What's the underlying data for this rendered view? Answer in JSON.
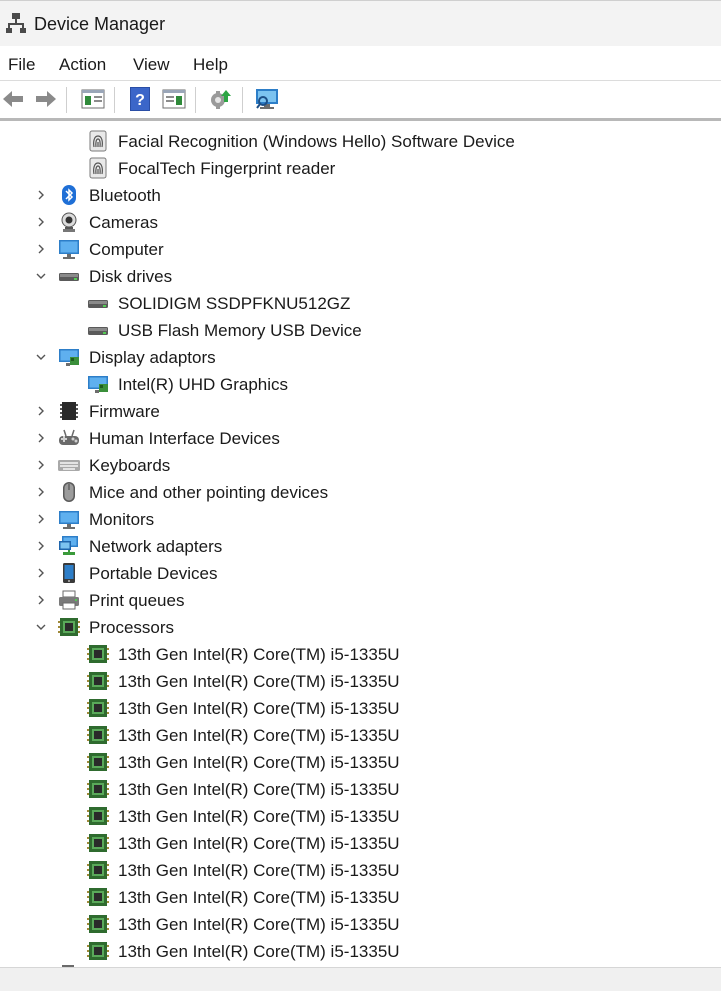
{
  "window": {
    "title": "Device Manager"
  },
  "menu": [
    "File",
    "Action",
    "View",
    "Help"
  ],
  "toolbar": {
    "buttons": [
      "back-arrow-icon",
      "forward-arrow-icon",
      "show-hide-tree-icon",
      "help-icon",
      "properties-icon",
      "update-driver-icon",
      "scan-hardware-icon"
    ]
  },
  "tree": [
    {
      "label": "Facial Recognition (Windows Hello) Software Device",
      "level": 2,
      "icon": "fingerprint-icon"
    },
    {
      "label": "FocalTech Fingerprint reader",
      "level": 2,
      "icon": "fingerprint-icon"
    },
    {
      "label": "Bluetooth",
      "level": 1,
      "expander": "collapsed",
      "icon": "bluetooth-icon"
    },
    {
      "label": "Cameras",
      "level": 1,
      "expander": "collapsed",
      "icon": "camera-icon"
    },
    {
      "label": "Computer",
      "level": 1,
      "expander": "collapsed",
      "icon": "computer-icon"
    },
    {
      "label": "Disk drives",
      "level": 1,
      "expander": "expanded",
      "icon": "disk-drive-icon"
    },
    {
      "label": "SOLIDIGM SSDPFKNU512GZ",
      "level": 2,
      "icon": "disk-drive-icon"
    },
    {
      "label": "USB Flash Memory USB Device",
      "level": 2,
      "icon": "disk-drive-icon"
    },
    {
      "label": "Display adaptors",
      "level": 1,
      "expander": "expanded",
      "icon": "display-adapter-icon"
    },
    {
      "label": "Intel(R) UHD Graphics",
      "level": 2,
      "icon": "display-adapter-icon"
    },
    {
      "label": "Firmware",
      "level": 1,
      "expander": "collapsed",
      "icon": "firmware-icon"
    },
    {
      "label": "Human Interface Devices",
      "level": 1,
      "expander": "collapsed",
      "icon": "hid-icon"
    },
    {
      "label": "Keyboards",
      "level": 1,
      "expander": "collapsed",
      "icon": "keyboard-icon"
    },
    {
      "label": "Mice and other pointing devices",
      "level": 1,
      "expander": "collapsed",
      "icon": "mouse-icon"
    },
    {
      "label": "Monitors",
      "level": 1,
      "expander": "collapsed",
      "icon": "monitor-icon"
    },
    {
      "label": "Network adapters",
      "level": 1,
      "expander": "collapsed",
      "icon": "network-adapter-icon"
    },
    {
      "label": "Portable Devices",
      "level": 1,
      "expander": "collapsed",
      "icon": "portable-device-icon"
    },
    {
      "label": "Print queues",
      "level": 1,
      "expander": "collapsed",
      "icon": "printer-icon"
    },
    {
      "label": "Processors",
      "level": 1,
      "expander": "expanded",
      "icon": "processor-icon"
    },
    {
      "label": "13th Gen Intel(R) Core(TM) i5-1335U",
      "level": 2,
      "icon": "processor-icon"
    },
    {
      "label": "13th Gen Intel(R) Core(TM) i5-1335U",
      "level": 2,
      "icon": "processor-icon"
    },
    {
      "label": "13th Gen Intel(R) Core(TM) i5-1335U",
      "level": 2,
      "icon": "processor-icon"
    },
    {
      "label": "13th Gen Intel(R) Core(TM) i5-1335U",
      "level": 2,
      "icon": "processor-icon"
    },
    {
      "label": "13th Gen Intel(R) Core(TM) i5-1335U",
      "level": 2,
      "icon": "processor-icon"
    },
    {
      "label": "13th Gen Intel(R) Core(TM) i5-1335U",
      "level": 2,
      "icon": "processor-icon"
    },
    {
      "label": "13th Gen Intel(R) Core(TM) i5-1335U",
      "level": 2,
      "icon": "processor-icon"
    },
    {
      "label": "13th Gen Intel(R) Core(TM) i5-1335U",
      "level": 2,
      "icon": "processor-icon"
    },
    {
      "label": "13th Gen Intel(R) Core(TM) i5-1335U",
      "level": 2,
      "icon": "processor-icon"
    },
    {
      "label": "13th Gen Intel(R) Core(TM) i5-1335U",
      "level": 2,
      "icon": "processor-icon"
    },
    {
      "label": "13th Gen Intel(R) Core(TM) i5-1335U",
      "level": 2,
      "icon": "processor-icon"
    },
    {
      "label": "13th Gen Intel(R) Core(TM) i5-1335U",
      "level": 2,
      "icon": "processor-icon"
    }
  ]
}
